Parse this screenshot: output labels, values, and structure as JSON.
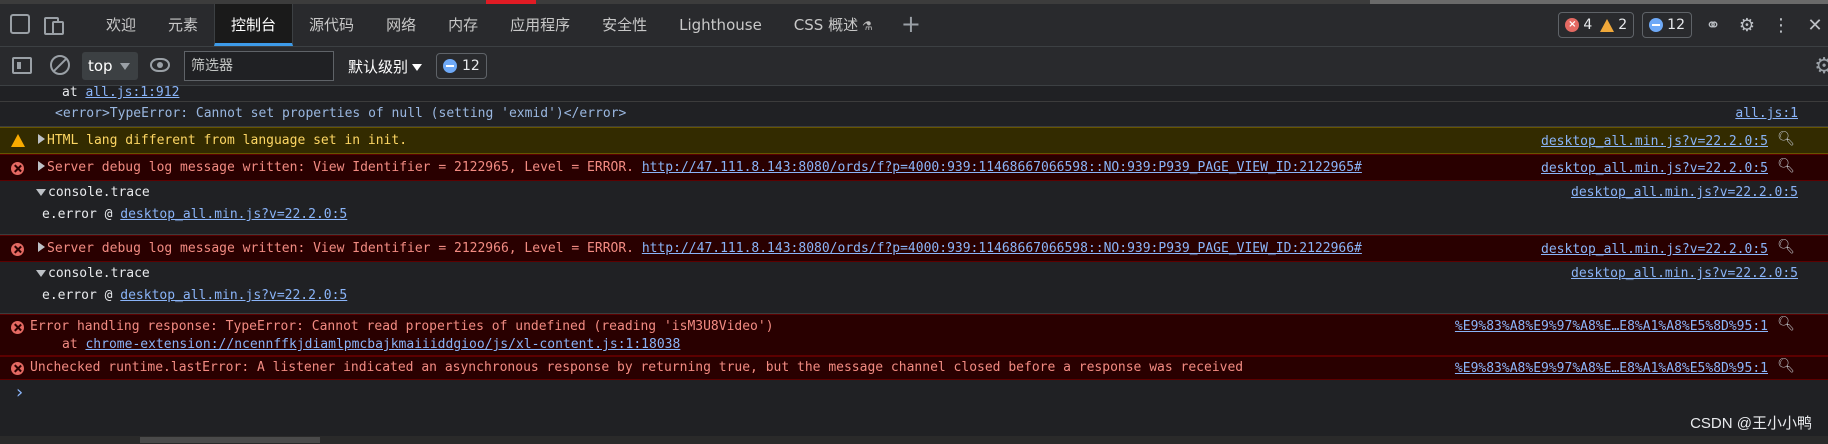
{
  "tabs": [
    "欢迎",
    "元素",
    "控制台",
    "源代码",
    "网络",
    "内存",
    "应用程序",
    "安全性",
    "Lighthouse",
    "CSS 概述"
  ],
  "active_tab": "控制台",
  "counts": {
    "errors": "4",
    "warnings": "2",
    "messages": "12"
  },
  "toolbar": {
    "context": "top",
    "filter_placeholder": "筛选器",
    "level": "默认级别",
    "badge": "12"
  },
  "console": {
    "line0_prefix": "at ",
    "line0_link": "all.js:1:912",
    "line1_text": "<error>TypeError: Cannot set properties of null (setting 'exmid')</error>",
    "line1_src": "all.js:1",
    "warn_text": "HTML lang different from language set in init.",
    "warn_src": "desktop_all.min.js?v=22.2.0:5",
    "err1_text": "Server debug log message written: View Identifier = 2122965, Level = ERROR.",
    "err1_link": "http://47.111.8.143:8080/ords/f?p=4000:939:11468667066598::NO:939:P939_PAGE_VIEW_ID:2122965#",
    "err1_src": "desktop_all.min.js?v=22.2.0:5",
    "trace1_label": "console.trace",
    "trace1_src": "desktop_all.min.js?v=22.2.0:5",
    "trace1_frame": "e.error @ ",
    "trace1_frame_link": "desktop_all.min.js?v=22.2.0:5",
    "err2_text": "Server debug log message written: View Identifier = 2122966, Level = ERROR.",
    "err2_link": "http://47.111.8.143:8080/ords/f?p=4000:939:11468667066598::NO:939:P939_PAGE_VIEW_ID:2122966#",
    "err2_src": "desktop_all.min.js?v=22.2.0:5",
    "trace2_label": "console.trace",
    "trace2_src": "desktop_all.min.js?v=22.2.0:5",
    "trace2_frame": "e.error @ ",
    "trace2_frame_link": "desktop_all.min.js?v=22.2.0:5",
    "err3_text": "Error handling response: TypeError: Cannot read properties of undefined (reading 'isM3U8Video')",
    "err3_at": "at ",
    "err3_at_link": "chrome-extension://ncennffkjdiamlpmcbajkmaiiiddgioo/js/xl-content.js:1:18038",
    "err3_src": "%E9%83%A8%E9%97%A8%E…E8%A1%A8%E5%8D%95:1",
    "err4_text": "Unchecked runtime.lastError: A listener indicated an asynchronous response by returning true, but the message channel closed before a response was received",
    "err4_src": "%E9%83%A8%E9%97%A8%E…E8%A1%A8%E5%8D%95:1"
  },
  "watermark": "CSDN @王小小鸭"
}
